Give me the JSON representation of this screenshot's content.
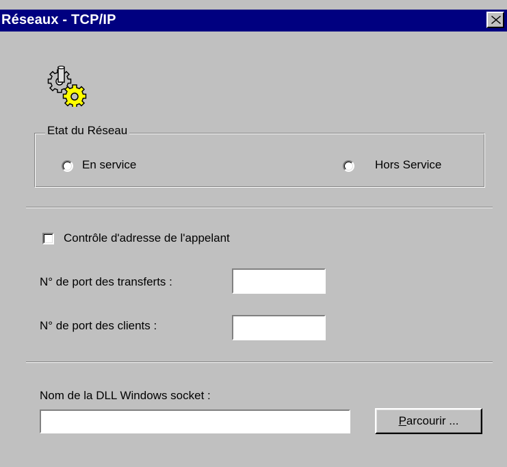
{
  "window": {
    "title": "Réseaux - TCP/IP",
    "close_icon": "close-icon"
  },
  "icon": "network-gears-icon",
  "network_state": {
    "group_label": "Etat du Réseau",
    "options": [
      {
        "label": "En service",
        "selected": false
      },
      {
        "label": "Hors Service",
        "selected": false
      }
    ]
  },
  "caller_address_check": {
    "label": "Contrôle d'adresse de l'appelant",
    "checked": false
  },
  "transfer_port": {
    "label": "N° de port des transferts :",
    "value": ""
  },
  "client_port": {
    "label": "N° de port des clients :",
    "value": ""
  },
  "dll": {
    "label": "Nom de la DLL Windows socket :",
    "value": "",
    "browse_button": {
      "mnemonic": "P",
      "rest": "arcourir ..."
    }
  }
}
